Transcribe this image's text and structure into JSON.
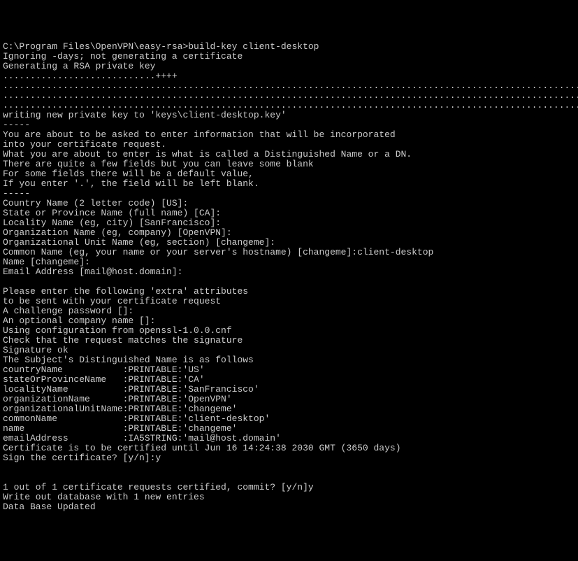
{
  "terminal": {
    "lines": [
      "C:\\Program Files\\OpenVPN\\easy-rsa>build-key client-desktop",
      "Ignoring -days; not generating a certificate",
      "Generating a RSA private key",
      "............................++++",
      "...................................................................................................................",
      "...................................................................................................................",
      "...............................................................................................................++++",
      "writing new private key to 'keys\\client-desktop.key'",
      "-----",
      "You are about to be asked to enter information that will be incorporated",
      "into your certificate request.",
      "What you are about to enter is what is called a Distinguished Name or a DN.",
      "There are quite a few fields but you can leave some blank",
      "For some fields there will be a default value,",
      "If you enter '.', the field will be left blank.",
      "-----",
      "Country Name (2 letter code) [US]:",
      "State or Province Name (full name) [CA]:",
      "Locality Name (eg, city) [SanFrancisco]:",
      "Organization Name (eg, company) [OpenVPN]:",
      "Organizational Unit Name (eg, section) [changeme]:",
      "Common Name (eg, your name or your server's hostname) [changeme]:client-desktop",
      "Name [changeme]:",
      "Email Address [mail@host.domain]:",
      "",
      "Please enter the following 'extra' attributes",
      "to be sent with your certificate request",
      "A challenge password []:",
      "An optional company name []:",
      "Using configuration from openssl-1.0.0.cnf",
      "Check that the request matches the signature",
      "Signature ok",
      "The Subject's Distinguished Name is as follows",
      "countryName           :PRINTABLE:'US'",
      "stateOrProvinceName   :PRINTABLE:'CA'",
      "localityName          :PRINTABLE:'SanFrancisco'",
      "organizationName      :PRINTABLE:'OpenVPN'",
      "organizationalUnitName:PRINTABLE:'changeme'",
      "commonName            :PRINTABLE:'client-desktop'",
      "name                  :PRINTABLE:'changeme'",
      "emailAddress          :IA5STRING:'mail@host.domain'",
      "Certificate is to be certified until Jun 16 14:24:38 2030 GMT (3650 days)",
      "Sign the certificate? [y/n]:y",
      "",
      "",
      "1 out of 1 certificate requests certified, commit? [y/n]y",
      "Write out database with 1 new entries",
      "Data Base Updated"
    ]
  }
}
